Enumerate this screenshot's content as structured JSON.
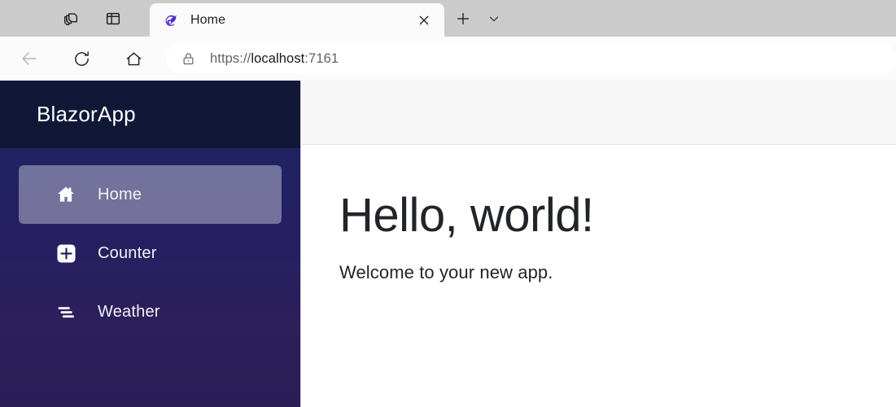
{
  "browser": {
    "tabstrip": {
      "tab_group_icon": "copy-stack-icon",
      "split_screen_icon": "split-screen-icon",
      "tab": {
        "favicon": "blazor-logo-icon",
        "title": "Home",
        "close_icon": "close-icon"
      },
      "new_tab_icon": "plus-icon",
      "tab_menu_icon": "chevron-down-icon"
    },
    "toolbar": {
      "back_icon": "back-arrow-icon",
      "reload_icon": "reload-icon",
      "home_icon": "home-icon",
      "lock_icon": "lock-icon",
      "url_scheme": "https://",
      "url_host": "localhost",
      "url_port": ":7161"
    }
  },
  "page": {
    "sidebar": {
      "brand": "BlazorApp",
      "items": [
        {
          "label": "Home",
          "icon": "house-filled-icon",
          "active": true
        },
        {
          "label": "Counter",
          "icon": "plus-square-icon",
          "active": false
        },
        {
          "label": "Weather",
          "icon": "list-lines-icon",
          "active": false
        }
      ]
    },
    "main": {
      "title": "Hello, world!",
      "subtitle": "Welcome to your new app."
    }
  },
  "colors": {
    "sidebar_header": "#111737",
    "sidebar_gradient_top": "#1b2561",
    "sidebar_gradient_bottom": "#2a1c57",
    "blazor_purple": "#512bd4",
    "tabstrip_bg": "#cbcbcb",
    "toolbar_bg": "#fbfbfb"
  }
}
